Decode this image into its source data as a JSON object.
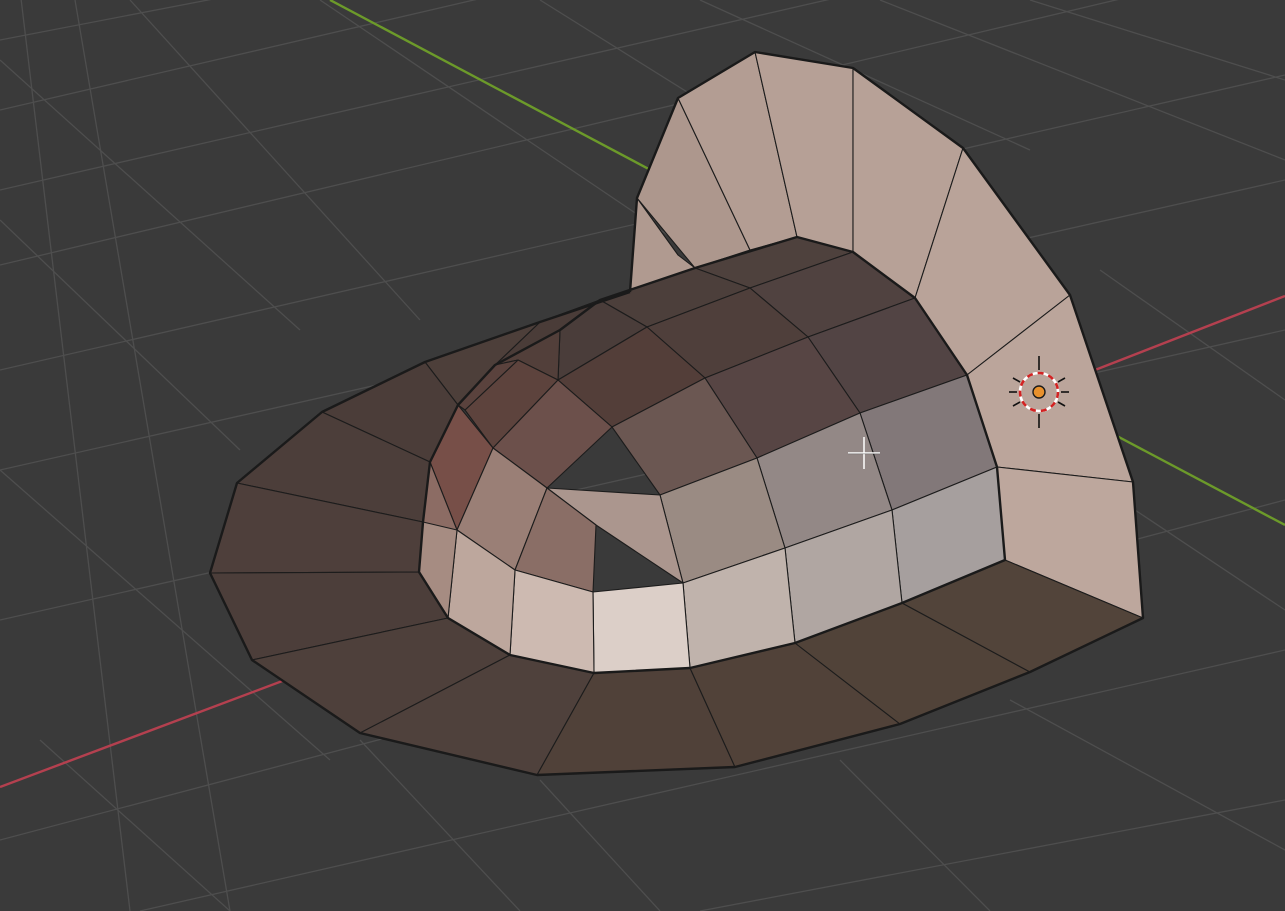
{
  "viewport": {
    "background": "#3a3a3a",
    "grid_color": "#4e4e4e",
    "axis_x_color": "#b4404f",
    "axis_y_color": "#6c9a2a"
  },
  "mesh": {
    "shading": "solid",
    "base_color": "#4f403b",
    "wall_color": "#b9a197",
    "cap_highlight_color": "#ddd0c8",
    "edge_color": "#1c1c1c"
  },
  "light": {
    "icon": "light-icon",
    "selected_color": "#e8902c",
    "ring_color": "#d22222"
  },
  "cursor": {
    "icon": "crosshair-icon"
  }
}
